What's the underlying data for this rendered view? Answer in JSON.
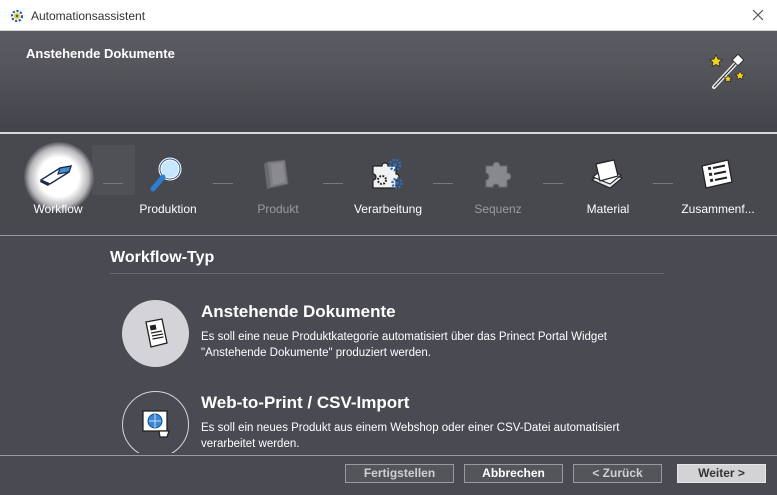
{
  "window": {
    "title": "Automationsassistent"
  },
  "header": {
    "title": "Anstehende Dokumente"
  },
  "steps": [
    {
      "label": "Workflow",
      "state": "active",
      "icon": "eraser-icon"
    },
    {
      "label": "Produktion",
      "state": "enabled",
      "icon": "magnifier-icon"
    },
    {
      "label": "Produkt",
      "state": "disabled",
      "icon": "book-icon"
    },
    {
      "label": "Verarbeitung",
      "state": "enabled",
      "icon": "puzzle-gears-icon"
    },
    {
      "label": "Sequenz",
      "state": "disabled",
      "icon": "puzzle-icon"
    },
    {
      "label": "Material",
      "state": "enabled",
      "icon": "paper-stack-icon"
    },
    {
      "label": "Zusammenf...",
      "state": "enabled",
      "icon": "list-icon"
    }
  ],
  "section": {
    "title": "Workflow-Typ"
  },
  "options": [
    {
      "title": "Anstehende Dokumente",
      "desc_line1": "Es soll eine neue Produktkategorie automatisiert über das Prinect Portal Widget",
      "desc_line2": "\"Anstehende Dokumente\" produziert werden.",
      "selected": true,
      "icon": "document-icon"
    },
    {
      "title": "Web-to-Print / CSV-Import",
      "desc_line1": "Es soll ein neues Produkt aus einem Webshop oder einer CSV-Datei automatisiert",
      "desc_line2": "verarbeitet werden.",
      "selected": false,
      "icon": "web-cart-icon"
    }
  ],
  "footer": {
    "finish_label": "Fertigstellen",
    "cancel_label": "Abbrechen",
    "back_label": "< Zurück",
    "next_label": "Weiter >"
  }
}
